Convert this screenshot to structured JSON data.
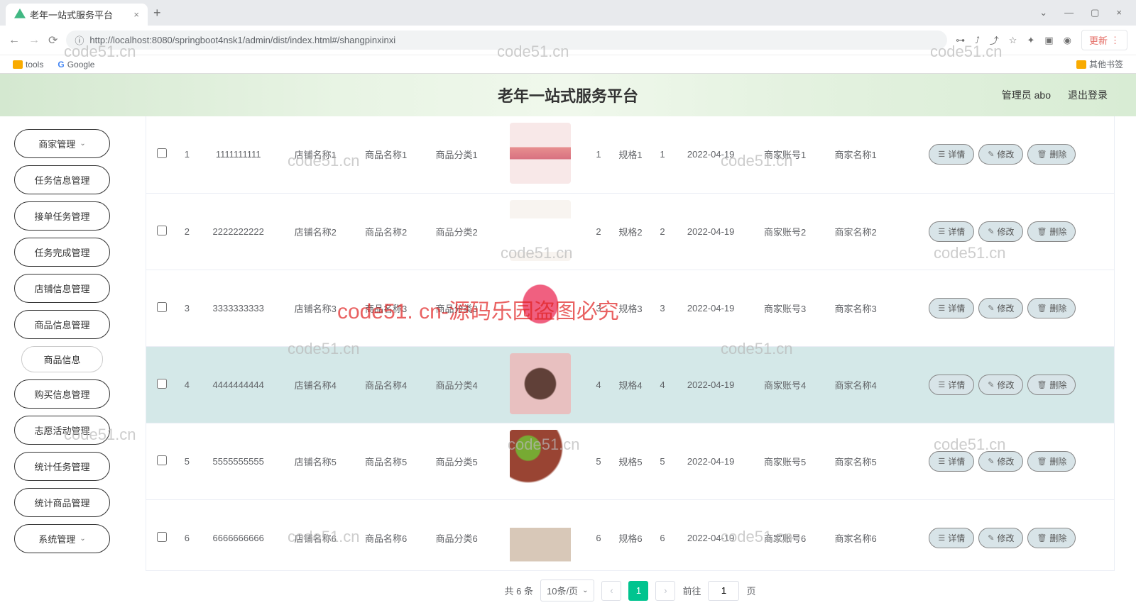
{
  "browser": {
    "tab_title": "老年一站式服务平台",
    "url": "http://localhost:8080/springboot4nsk1/admin/dist/index.html#/shangpinxinxi",
    "update_label": "更新",
    "bookmarks": {
      "tools": "tools",
      "google": "Google",
      "other": "其他书签"
    }
  },
  "header": {
    "title": "老年一站式服务平台",
    "admin_label": "管理员 abo",
    "logout": "退出登录"
  },
  "sidebar": {
    "items": [
      {
        "label": "商家管理",
        "expand": true
      },
      {
        "label": "任务信息管理"
      },
      {
        "label": "接单任务管理"
      },
      {
        "label": "任务完成管理"
      },
      {
        "label": "店铺信息管理"
      },
      {
        "label": "商品信息管理"
      },
      {
        "label": "商品信息",
        "sub": true
      },
      {
        "label": "购买信息管理"
      },
      {
        "label": "志愿活动管理"
      },
      {
        "label": "统计任务管理"
      },
      {
        "label": "统计商品管理"
      },
      {
        "label": "系统管理",
        "expand": true
      }
    ]
  },
  "table": {
    "rows": [
      {
        "idx": "1",
        "code": "1111111111",
        "store": "店铺名称1",
        "name": "商品名称1",
        "cat": "商品分类1",
        "img": "img1",
        "stock": "1",
        "spec": "规格1",
        "price": "1",
        "date": "2022-04-19",
        "acct": "商家账号1",
        "seller": "商家名称1"
      },
      {
        "idx": "2",
        "code": "2222222222",
        "store": "店铺名称2",
        "name": "商品名称2",
        "cat": "商品分类2",
        "img": "img2",
        "stock": "2",
        "spec": "规格2",
        "price": "2",
        "date": "2022-04-19",
        "acct": "商家账号2",
        "seller": "商家名称2"
      },
      {
        "idx": "3",
        "code": "3333333333",
        "store": "店铺名称3",
        "name": "商品名称3",
        "cat": "商品分类3",
        "img": "img3",
        "stock": "3",
        "spec": "规格3",
        "price": "3",
        "date": "2022-04-19",
        "acct": "商家账号3",
        "seller": "商家名称3"
      },
      {
        "idx": "4",
        "code": "4444444444",
        "store": "店铺名称4",
        "name": "商品名称4",
        "cat": "商品分类4",
        "img": "img4",
        "stock": "4",
        "spec": "规格4",
        "price": "4",
        "date": "2022-04-19",
        "acct": "商家账号4",
        "seller": "商家名称4",
        "hover": true
      },
      {
        "idx": "5",
        "code": "5555555555",
        "store": "店铺名称5",
        "name": "商品名称5",
        "cat": "商品分类5",
        "img": "img5",
        "stock": "5",
        "spec": "规格5",
        "price": "5",
        "date": "2022-04-19",
        "acct": "商家账号5",
        "seller": "商家名称5"
      },
      {
        "idx": "6",
        "code": "6666666666",
        "store": "店铺名称6",
        "name": "商品名称6",
        "cat": "商品分类6",
        "img": "img6",
        "stock": "6",
        "spec": "规格6",
        "price": "6",
        "date": "2022-04-19",
        "acct": "商家账号6",
        "seller": "商家名称6"
      }
    ],
    "actions": {
      "detail": "详情",
      "edit": "修改",
      "delete": "删除"
    }
  },
  "pagination": {
    "total_label": "共 6 条",
    "page_size": "10条/页",
    "current": "1",
    "goto_prefix": "前往",
    "goto_val": "1",
    "goto_suffix": "页"
  },
  "watermarks": {
    "wm": "code51.cn",
    "red": "code51. cn-源码乐园盗图必究"
  }
}
